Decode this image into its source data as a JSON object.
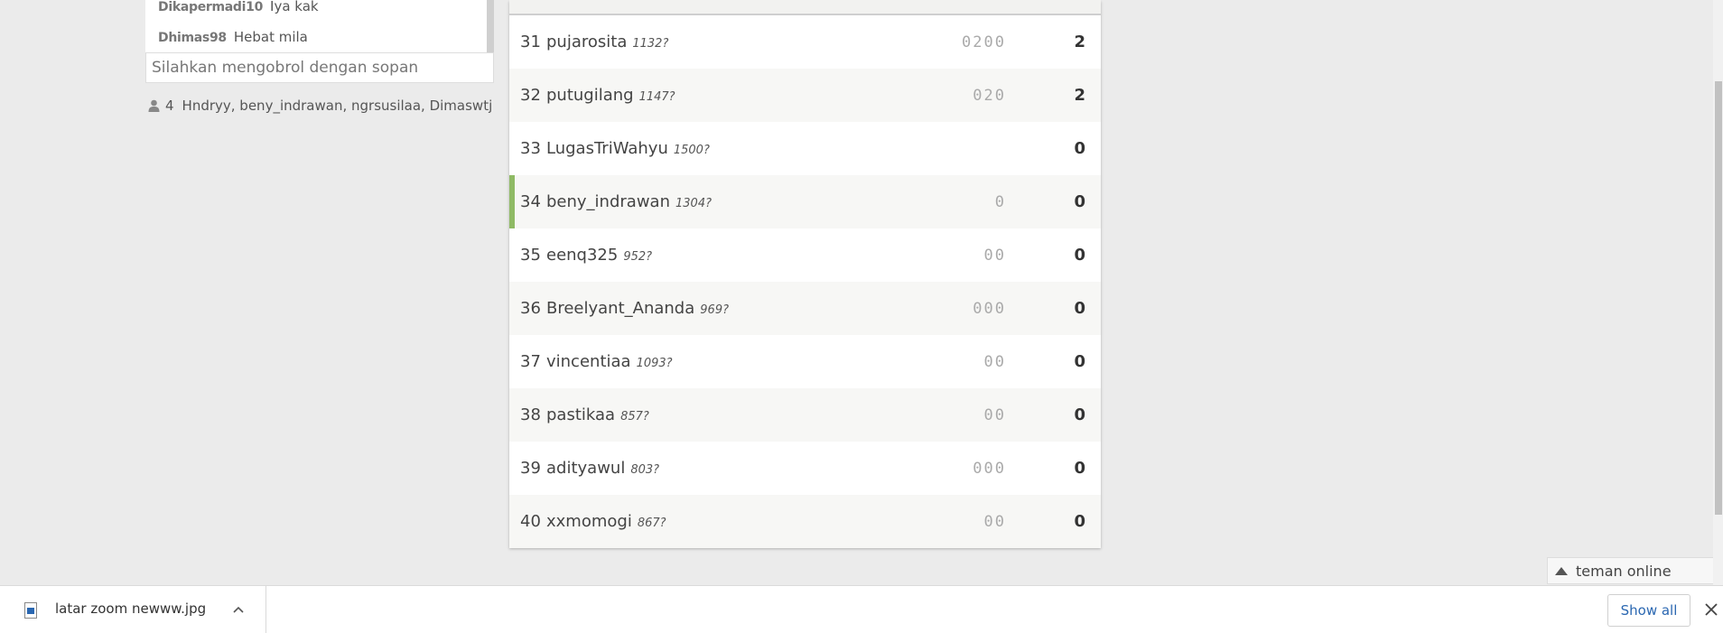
{
  "chat": {
    "messages": [
      {
        "user": "Dikapermadi10",
        "text": "Iya kak"
      },
      {
        "user": "Dhimas98",
        "text": "Hebat mila"
      }
    ],
    "input_placeholder": "Silahkan mengobrol dengan sopan",
    "online_count": "4",
    "online_users": "Hndryy, beny_indrawan, ngrsusilaa, Dimaswtj"
  },
  "scoreboard": {
    "rows": [
      {
        "rank": "31",
        "name": "pujarosita",
        "points": "1132?",
        "history": "0200",
        "score": "2"
      },
      {
        "rank": "32",
        "name": "putugilang",
        "points": "1147?",
        "history": "020",
        "score": "2"
      },
      {
        "rank": "33",
        "name": "LugasTriWahyu",
        "points": "1500?",
        "history": "",
        "score": "0"
      },
      {
        "rank": "34",
        "name": "beny_indrawan",
        "points": "1304?",
        "history": "0",
        "score": "0"
      },
      {
        "rank": "35",
        "name": "eenq325",
        "points": "952?",
        "history": "00",
        "score": "0"
      },
      {
        "rank": "36",
        "name": "Breelyant_Ananda",
        "points": "969?",
        "history": "000",
        "score": "0"
      },
      {
        "rank": "37",
        "name": "vincentiaa",
        "points": "1093?",
        "history": "00",
        "score": "0"
      },
      {
        "rank": "38",
        "name": "pastikaa",
        "points": "857?",
        "history": "00",
        "score": "0"
      },
      {
        "rank": "39",
        "name": "adityawul",
        "points": "803?",
        "history": "000",
        "score": "0"
      },
      {
        "rank": "40",
        "name": "xxmomogi",
        "points": "867?",
        "history": "00",
        "score": "0"
      }
    ]
  },
  "friends_tab": {
    "label": "teman online"
  },
  "downloads": {
    "file_name": "latar zoom newww.jpg",
    "show_all": "Show all"
  },
  "colors": {
    "current_user_marker": "#8fba64",
    "link_blue": "#2a67b1"
  },
  "icons": {
    "person": "person-icon",
    "file": "image-file-icon",
    "chevron": "chevron-up-icon",
    "close": "close-icon",
    "caret": "triangle-up-icon"
  }
}
